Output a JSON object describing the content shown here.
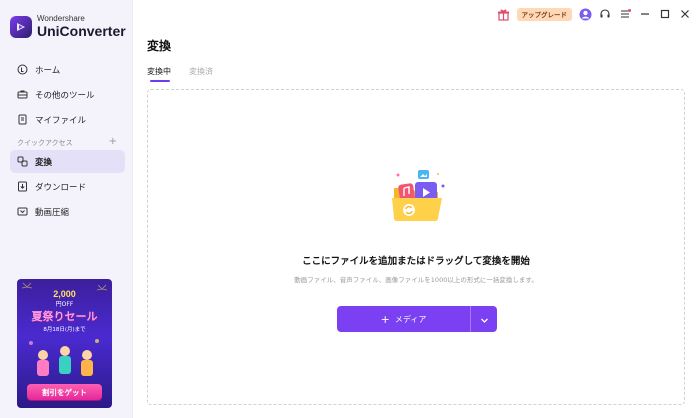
{
  "app": {
    "brand_small": "Wondershare",
    "brand_name": "UniConverter"
  },
  "sidebar": {
    "items": [
      {
        "label": "ホーム",
        "icon": "home-icon"
      },
      {
        "label": "その他のツール",
        "icon": "toolbox-icon"
      },
      {
        "label": "マイファイル",
        "icon": "file-icon"
      }
    ],
    "quick_access_label": "クイックアクセス",
    "quick_access_plus": "+",
    "quick_items": [
      {
        "label": "変換",
        "icon": "convert-icon",
        "active": true
      },
      {
        "label": "ダウンロード",
        "icon": "download-icon"
      },
      {
        "label": "動画圧縮",
        "icon": "compress-icon"
      }
    ]
  },
  "promo": {
    "top": "2,000",
    "off": "円OFF",
    "title": "夏祭りセール",
    "date": "8月18日(月)まで",
    "button": "割引をゲット"
  },
  "topbar": {
    "upgrade_label": "アップグレード"
  },
  "main": {
    "title": "変換",
    "tabs": [
      {
        "label": "変換中",
        "active": true
      },
      {
        "label": "変換済",
        "active": false
      }
    ],
    "drop_title": "ここにファイルを追加またはドラッグして変換を開始",
    "drop_subtitle": "動画ファイル、音声ファイル、画像ファイルを1000以上の形式に一括変換します。",
    "media_button": "メディア",
    "media_plus": "+"
  },
  "colors": {
    "accent": "#7a40f2",
    "active_bg": "#e4e0f7",
    "upgrade_bg": "#ffd8b8"
  }
}
